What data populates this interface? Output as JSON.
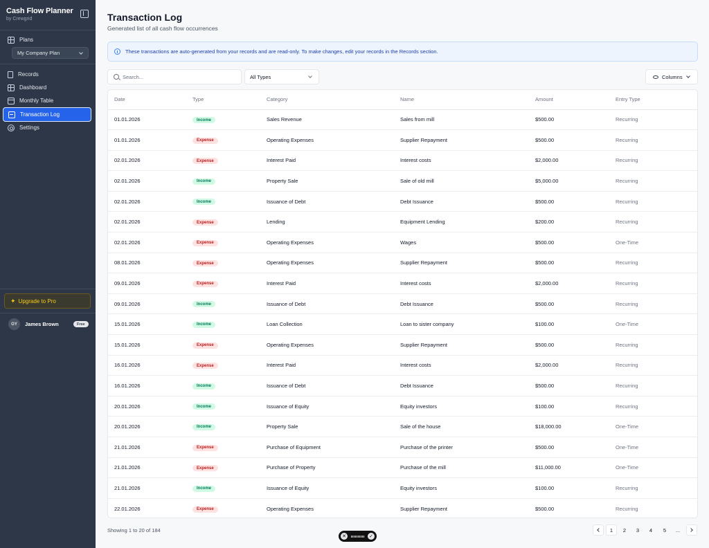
{
  "app": {
    "title": "Cash Flow Planner",
    "subtitle": "by Crewgrid"
  },
  "sidebar": {
    "plans_label": "Plans",
    "plan_selected": "My Company Plan",
    "items": [
      {
        "label": "Records",
        "icon": "document-icon"
      },
      {
        "label": "Dashboard",
        "icon": "dashboard-icon"
      },
      {
        "label": "Monthly Table",
        "icon": "table-icon"
      },
      {
        "label": "Transaction Log",
        "icon": "log-icon",
        "active": true
      },
      {
        "label": "Settings",
        "icon": "gear-icon"
      }
    ],
    "upgrade_label": "Upgrade to Pro",
    "user": {
      "initials": "OY",
      "name": "James Brown",
      "plan_badge": "Free"
    }
  },
  "page": {
    "title": "Transaction Log",
    "subtitle": "Generated list of all cash flow occurrences",
    "notice": "These transactions are auto-generated from your records and are read-only. To make changes, edit your records in the Records section."
  },
  "toolbar": {
    "search_placeholder": "Search...",
    "type_filter": "All Types",
    "columns_label": "Columns"
  },
  "table": {
    "columns": [
      "Date",
      "Type",
      "Category",
      "Name",
      "Amount",
      "Entry Type"
    ],
    "rows": [
      [
        "01.01.2026",
        "Income",
        "Sales Revenue",
        "Sales from mill",
        "$500.00",
        "Recurring"
      ],
      [
        "01.01.2026",
        "Expense",
        "Operating Expenses",
        "Supplier Repayment",
        "$500.00",
        "Recurring"
      ],
      [
        "02.01.2026",
        "Expense",
        "Interest Paid",
        "Interest costs",
        "$2,000.00",
        "Recurring"
      ],
      [
        "02.01.2026",
        "Income",
        "Property Sale",
        "Sale of old mill",
        "$5,000.00",
        "Recurring"
      ],
      [
        "02.01.2026",
        "Income",
        "Issuance of Debt",
        "Debt Issuance",
        "$500.00",
        "Recurring"
      ],
      [
        "02.01.2026",
        "Expense",
        "Lending",
        "Equipment Lending",
        "$200.00",
        "Recurring"
      ],
      [
        "02.01.2026",
        "Expense",
        "Operating Expenses",
        "Wages",
        "$500.00",
        "One-Time"
      ],
      [
        "08.01.2026",
        "Expense",
        "Operating Expenses",
        "Supplier Repayment",
        "$500.00",
        "Recurring"
      ],
      [
        "09.01.2026",
        "Expense",
        "Interest Paid",
        "Interest costs",
        "$2,000.00",
        "Recurring"
      ],
      [
        "09.01.2026",
        "Income",
        "Issuance of Debt",
        "Debt Issuance",
        "$500.00",
        "Recurring"
      ],
      [
        "15.01.2026",
        "Income",
        "Loan Collection",
        "Loan to sister company",
        "$100.00",
        "One-Time"
      ],
      [
        "15.01.2026",
        "Expense",
        "Operating Expenses",
        "Supplier Repayment",
        "$500.00",
        "Recurring"
      ],
      [
        "16.01.2026",
        "Expense",
        "Interest Paid",
        "Interest costs",
        "$2,000.00",
        "Recurring"
      ],
      [
        "16.01.2026",
        "Income",
        "Issuance of Debt",
        "Debt Issuance",
        "$500.00",
        "Recurring"
      ],
      [
        "20.01.2026",
        "Income",
        "Issuance of Equity",
        "Equity investors",
        "$100.00",
        "Recurring"
      ],
      [
        "20.01.2026",
        "Income",
        "Property Sale",
        "Sale of the house",
        "$18,000.00",
        "One-Time"
      ],
      [
        "21.01.2026",
        "Expense",
        "Purchase of Equipment",
        "Purchase of the printer",
        "$500.00",
        "One-Time"
      ],
      [
        "21.01.2026",
        "Expense",
        "Purchase of Property",
        "Purchase of the mill",
        "$11,000.00",
        "One-Time"
      ],
      [
        "21.01.2026",
        "Income",
        "Issuance of Equity",
        "Equity investors",
        "$100.00",
        "Recurring"
      ],
      [
        "22.01.2026",
        "Expense",
        "Operating Expenses",
        "Supplier Repayment",
        "$500.00",
        "Recurring"
      ]
    ]
  },
  "pagination": {
    "summary": "Showing 1 to 20 of 184",
    "pages": [
      "1",
      "2",
      "3",
      "4",
      "5"
    ],
    "current": "1",
    "ellipsis": "..."
  },
  "floating_toolbar": {
    "close_glyph": "✕",
    "confirm_glyph": "✓"
  },
  "colors": {
    "sidebar_bg": "#2d3748",
    "accent": "#2563eb",
    "income_bg": "#d1fae5",
    "income_text": "#047857",
    "expense_bg": "#fee2e2",
    "expense_text": "#b91c1c",
    "upgrade_text": "#facc15"
  }
}
